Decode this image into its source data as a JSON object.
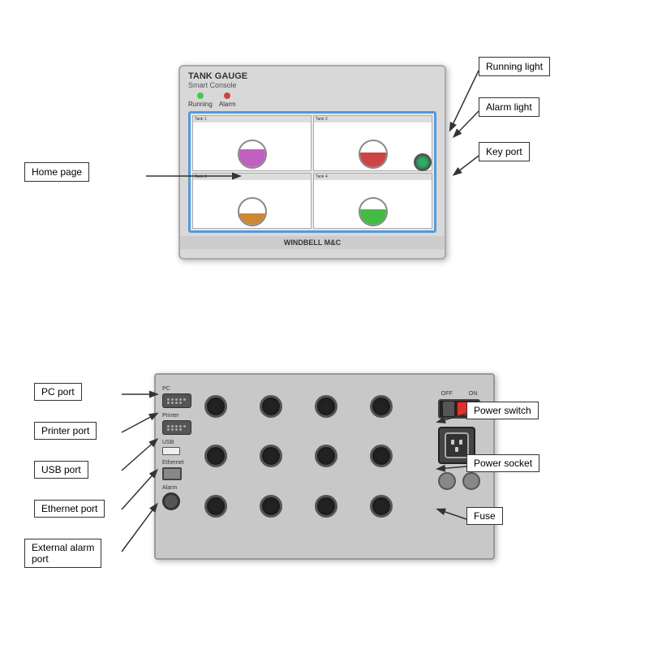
{
  "top": {
    "panel": {
      "title": "TANK GAUGE",
      "subtitle": "Smart Console",
      "brand": "WINDBELL M&C"
    },
    "labels": {
      "running_light": "Running light",
      "alarm_light": "Alarm light",
      "key_port": "Key port",
      "home_page": "Home page"
    },
    "leds": {
      "running": "Running",
      "alarm": "Alarm"
    }
  },
  "bottom": {
    "labels": {
      "pc_port": "PC port",
      "printer_port": "Printer port",
      "usb_port": "USB port",
      "ethernet_port": "Ethernet port",
      "external_alarm_port": "External alarm port",
      "power_switch": "Power switch",
      "power_socket": "Power socket",
      "fuse": "Fuse"
    },
    "port_labels": {
      "pc": "PC",
      "printer": "Printer",
      "usb": "USB",
      "ethernet": "Ethernet",
      "alarm": "Alarm"
    },
    "switch_labels": {
      "off": "OFF",
      "on": "ON"
    }
  },
  "tanks": [
    {
      "fill_color": "#c060c0",
      "fill_height": "70%",
      "label": "Tank 1"
    },
    {
      "fill_color": "#cc4444",
      "fill_height": "55%",
      "label": "Tank 2"
    },
    {
      "fill_color": "#cc8833",
      "fill_height": "45%",
      "label": "Tank 3"
    },
    {
      "fill_color": "#44bb44",
      "fill_height": "60%",
      "label": "Tank 4"
    }
  ]
}
